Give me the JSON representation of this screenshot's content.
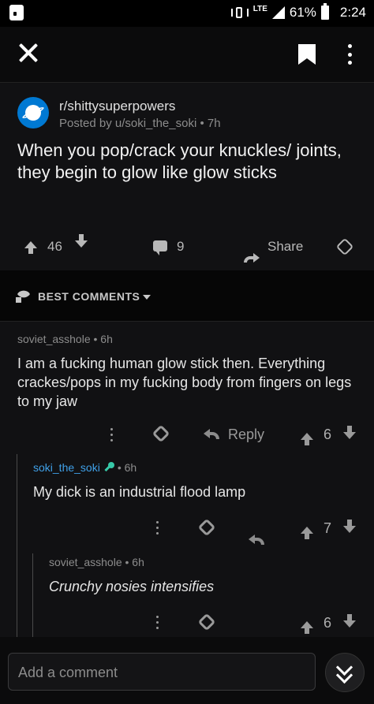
{
  "status_bar": {
    "network": "LTE",
    "battery": "61%",
    "time": "2:24"
  },
  "post": {
    "subreddit": "r/shittysuperpowers",
    "posted_by": "Posted by u/soki_the_soki • 7h",
    "title": "When you pop/crack your knuckles/ joints, they begin to glow like glow sticks",
    "score": "46",
    "comment_count": "9",
    "share_label": "Share"
  },
  "sort": {
    "label": "BEST COMMENTS"
  },
  "comments": [
    {
      "user": "soviet_asshole",
      "age": "• 6h",
      "body": "I am a fucking human glow stick then. Everything crackes/pops in my fucking body from fingers on legs to my jaw",
      "reply_label": "Reply",
      "score": "6"
    },
    {
      "user": "soki_the_soki",
      "age": "• 6h",
      "body": "My dick is an industrial flood lamp",
      "score": "7"
    },
    {
      "user": "soviet_asshole",
      "age": "• 6h",
      "body": "Crunchy nosies intensifies",
      "score": "6"
    }
  ],
  "composer": {
    "placeholder": "Add a comment"
  },
  "colors": {
    "background": "#0b0b0c",
    "card": "#111113",
    "op_username": "#3fa0e8",
    "flair": "#37c9a8",
    "subreddit_icon": "#0079d3"
  },
  "icons": [
    "close-icon",
    "bookmark-icon",
    "overflow-menu-icon",
    "upvote-icon",
    "downvote-icon",
    "comment-icon",
    "share-icon",
    "award-icon",
    "rocket-icon",
    "reply-icon",
    "chevron-down-icon"
  ]
}
